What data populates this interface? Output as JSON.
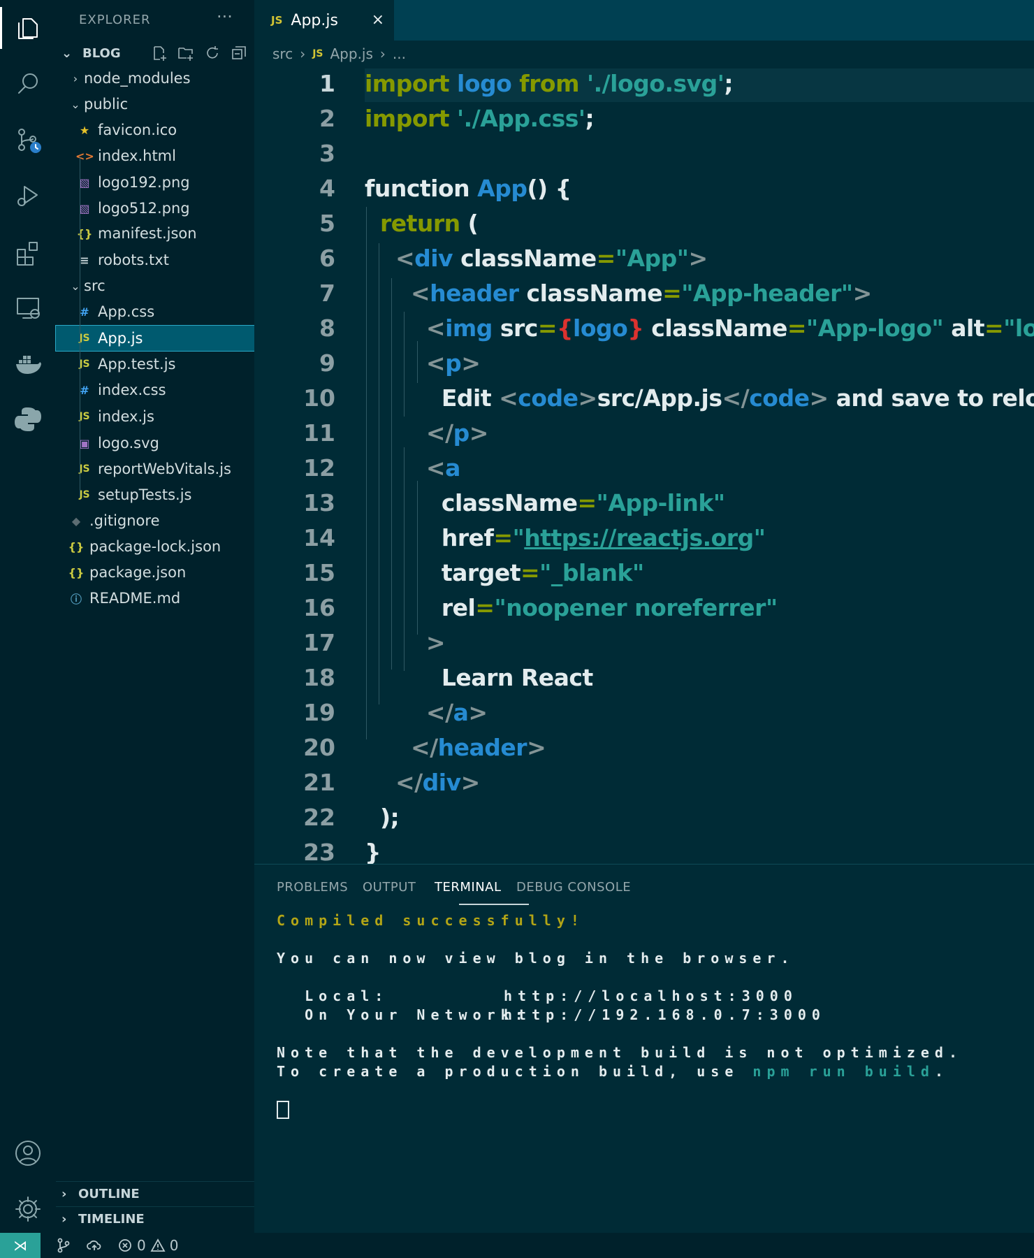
{
  "explorer": {
    "title": "EXPLORER",
    "more": "···",
    "root_label": "BLOG",
    "items": [
      {
        "label": "node_modules",
        "twisty": "›",
        "icon": ""
      },
      {
        "label": "public",
        "twisty": "⌄",
        "icon": ""
      },
      {
        "label": "favicon.ico",
        "twisty": "",
        "icon": "★"
      },
      {
        "label": "index.html",
        "twisty": "",
        "icon": "<>"
      },
      {
        "label": "logo192.png",
        "twisty": "",
        "icon": "▧"
      },
      {
        "label": "logo512.png",
        "twisty": "",
        "icon": "▧"
      },
      {
        "label": "manifest.json",
        "twisty": "",
        "icon": "{}"
      },
      {
        "label": "robots.txt",
        "twisty": "",
        "icon": "≡"
      },
      {
        "label": "src",
        "twisty": "⌄",
        "icon": ""
      },
      {
        "label": "App.css",
        "twisty": "",
        "icon": "#"
      },
      {
        "label": "App.js",
        "twisty": "",
        "icon": "JS"
      },
      {
        "label": "App.test.js",
        "twisty": "",
        "icon": "JS"
      },
      {
        "label": "index.css",
        "twisty": "",
        "icon": "#"
      },
      {
        "label": "index.js",
        "twisty": "",
        "icon": "JS"
      },
      {
        "label": "logo.svg",
        "twisty": "",
        "icon": "▣"
      },
      {
        "label": "reportWebVitals.js",
        "twisty": "",
        "icon": "JS"
      },
      {
        "label": "setupTests.js",
        "twisty": "",
        "icon": "JS"
      },
      {
        "label": ".gitignore",
        "twisty": "",
        "icon": "◆"
      },
      {
        "label": "package-lock.json",
        "twisty": "",
        "icon": "{}"
      },
      {
        "label": "package.json",
        "twisty": "",
        "icon": "{}"
      },
      {
        "label": "README.md",
        "twisty": "",
        "icon": "ⓘ"
      }
    ],
    "outline": "OUTLINE",
    "timeline": "TIMELINE"
  },
  "tab": {
    "lang": "JS",
    "label": "App.js",
    "close": "×"
  },
  "breadcrumb": {
    "folder": "src",
    "sep": "›",
    "lang": "JS",
    "file": "App.js",
    "more": "..."
  },
  "editor": {
    "line_numbers": [
      "1",
      "2",
      "3",
      "4",
      "5",
      "6",
      "7",
      "8",
      "9",
      "10",
      "11",
      "12",
      "13",
      "14",
      "15",
      "16",
      "17",
      "18",
      "19",
      "20",
      "21",
      "22",
      "23"
    ],
    "lines": [
      [
        [
          "k",
          "import "
        ],
        [
          "t",
          "logo "
        ],
        [
          "k",
          "from "
        ],
        [
          "s",
          "'./logo.svg'"
        ],
        [
          "w",
          ";"
        ]
      ],
      [
        [
          "k",
          "import "
        ],
        [
          "s",
          "'./App.css'"
        ],
        [
          "w",
          ";"
        ]
      ],
      [],
      [
        [
          "w",
          "function "
        ],
        [
          "f",
          "App"
        ],
        [
          "w",
          "() {"
        ]
      ],
      [
        [
          "w",
          "  "
        ],
        [
          "k",
          "return"
        ],
        [
          "w",
          " ("
        ]
      ],
      [
        [
          "w",
          "    "
        ],
        [
          "p",
          "<"
        ],
        [
          "t",
          "div "
        ],
        [
          "w",
          "className"
        ],
        [
          "k",
          "="
        ],
        [
          "s",
          "\"App\""
        ],
        [
          "p",
          ">"
        ]
      ],
      [
        [
          "w",
          "      "
        ],
        [
          "p",
          "<"
        ],
        [
          "t",
          "header "
        ],
        [
          "w",
          "className"
        ],
        [
          "k",
          "="
        ],
        [
          "s",
          "\"App-header\""
        ],
        [
          "p",
          ">"
        ]
      ],
      [
        [
          "w",
          "        "
        ],
        [
          "p",
          "<"
        ],
        [
          "t",
          "img "
        ],
        [
          "w",
          "src"
        ],
        [
          "k",
          "="
        ],
        [
          "r",
          "{"
        ],
        [
          "t",
          "logo"
        ],
        [
          "r",
          "}"
        ],
        [
          "w",
          " className"
        ],
        [
          "k",
          "="
        ],
        [
          "s",
          "\"App-logo\""
        ],
        [
          "w",
          " alt"
        ],
        [
          "k",
          "="
        ],
        [
          "s",
          "\"logo\""
        ],
        [
          "p",
          " />"
        ]
      ],
      [
        [
          "w",
          "        "
        ],
        [
          "p",
          "<"
        ],
        [
          "t",
          "p"
        ],
        [
          "p",
          ">"
        ]
      ],
      [
        [
          "w",
          "          Edit "
        ],
        [
          "p",
          "<"
        ],
        [
          "t",
          "code"
        ],
        [
          "p",
          ">"
        ],
        [
          "w",
          "src/App.js"
        ],
        [
          "p",
          "</"
        ],
        [
          "t",
          "code"
        ],
        [
          "p",
          ">"
        ],
        [
          "w",
          " and save to reload."
        ]
      ],
      [
        [
          "w",
          "        "
        ],
        [
          "p",
          "</"
        ],
        [
          "t",
          "p"
        ],
        [
          "p",
          ">"
        ]
      ],
      [
        [
          "w",
          "        "
        ],
        [
          "p",
          "<"
        ],
        [
          "t",
          "a"
        ]
      ],
      [
        [
          "w",
          "          className"
        ],
        [
          "k",
          "="
        ],
        [
          "s",
          "\"App-link\""
        ]
      ],
      [
        [
          "w",
          "          href"
        ],
        [
          "k",
          "="
        ],
        [
          "s",
          "\""
        ],
        [
          "u",
          "https://reactjs.org"
        ],
        [
          "s",
          "\""
        ]
      ],
      [
        [
          "w",
          "          target"
        ],
        [
          "k",
          "="
        ],
        [
          "s",
          "\"_blank\""
        ]
      ],
      [
        [
          "w",
          "          rel"
        ],
        [
          "k",
          "="
        ],
        [
          "s",
          "\"noopener noreferrer\""
        ]
      ],
      [
        [
          "w",
          "        "
        ],
        [
          "p",
          ">"
        ]
      ],
      [
        [
          "w",
          "          Learn React"
        ]
      ],
      [
        [
          "w",
          "        "
        ],
        [
          "p",
          "</"
        ],
        [
          "t",
          "a"
        ],
        [
          "p",
          ">"
        ]
      ],
      [
        [
          "w",
          "      "
        ],
        [
          "p",
          "</"
        ],
        [
          "t",
          "header"
        ],
        [
          "p",
          ">"
        ]
      ],
      [
        [
          "w",
          "    "
        ],
        [
          "p",
          "</"
        ],
        [
          "t",
          "div"
        ],
        [
          "p",
          ">"
        ]
      ],
      [
        [
          "w",
          "  );"
        ]
      ],
      [
        [
          "w",
          "}"
        ]
      ]
    ]
  },
  "panel": {
    "tabs": [
      "PROBLEMS",
      "OUTPUT",
      "TERMINAL",
      "DEBUG CONSOLE"
    ],
    "active_tab": "TERMINAL",
    "terminal": {
      "compiled": "Compiled successfully!",
      "view": "You can now view blog in the browser.",
      "local_label": "  Local:",
      "local_url": "http://localhost:3000",
      "network_label": "  On Your Network:",
      "network_url": "http://192.168.0.7:3000",
      "note1": "Note that the development build is not optimized.",
      "note2_prefix": "To create a production build, use ",
      "note2_cmd": "npm run build",
      "note2_suffix": "."
    }
  },
  "status": {
    "errors": "0",
    "warnings": "0",
    "remote_icon": "remote-icon"
  },
  "colors": {
    "accent": "#2aa198",
    "keyword": "#859900",
    "tag": "#268bd2",
    "background": "#002b36"
  }
}
